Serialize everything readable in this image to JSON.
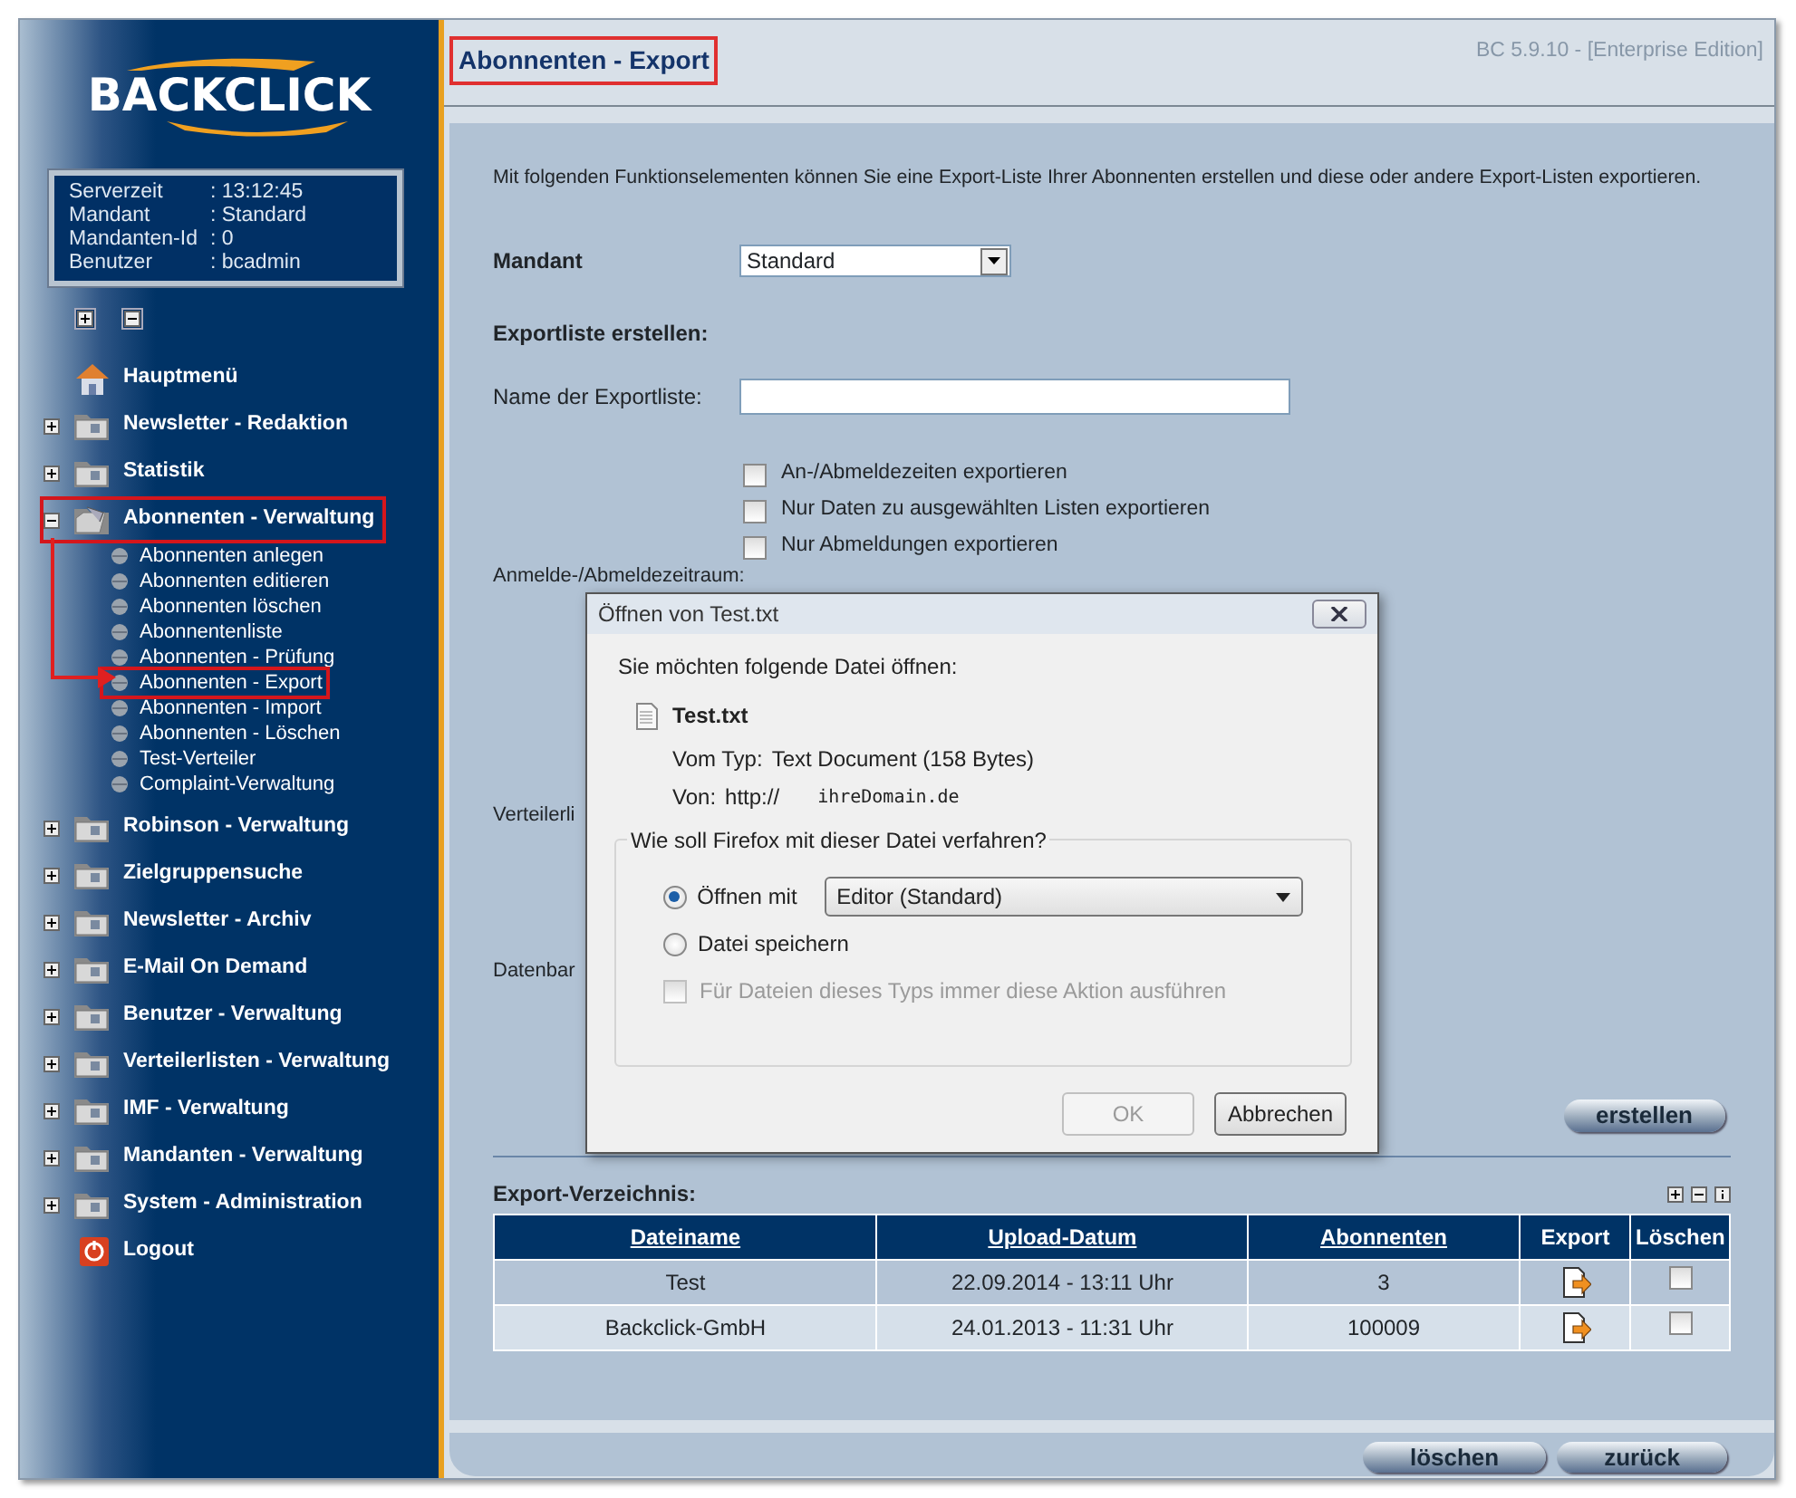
{
  "sidebar": {
    "logo": "BACKCLICK",
    "info": [
      {
        "label": "Serverzeit",
        "value": ":  13:12:45"
      },
      {
        "label": "Mandant",
        "value": ": Standard"
      },
      {
        "label": "Mandanten-Id",
        "value": ": 0"
      },
      {
        "label": "Benutzer",
        "value": ": bcadmin"
      }
    ],
    "items": [
      {
        "label": "Hauptmenü",
        "kind": "home"
      },
      {
        "label": "Newsletter - Redaktion",
        "kind": "folder",
        "expanded": false
      },
      {
        "label": "Statistik",
        "kind": "folder",
        "expanded": false
      },
      {
        "label": "Abonnenten - Verwaltung",
        "kind": "folder",
        "expanded": true,
        "children": [
          {
            "label": "Abonnenten anlegen",
            "selected": false
          },
          {
            "label": "Abonnenten editieren",
            "selected": false
          },
          {
            "label": "Abonnenten löschen",
            "selected": false
          },
          {
            "label": "Abonnentenliste",
            "selected": false
          },
          {
            "label": "Abonnenten - Prüfung",
            "selected": false
          },
          {
            "label": "Abonnenten - Export",
            "selected": true
          },
          {
            "label": "Abonnenten - Import",
            "selected": false
          },
          {
            "label": "Abonnenten - Löschen",
            "selected": false
          },
          {
            "label": "Test-Verteiler",
            "selected": false
          },
          {
            "label": "Complaint-Verwaltung",
            "selected": false
          }
        ]
      },
      {
        "label": "Robinson - Verwaltung",
        "kind": "folder",
        "expanded": false
      },
      {
        "label": "Zielgruppensuche",
        "kind": "folder",
        "expanded": false
      },
      {
        "label": "Newsletter - Archiv",
        "kind": "folder",
        "expanded": false
      },
      {
        "label": "E-Mail On Demand",
        "kind": "folder",
        "expanded": false
      },
      {
        "label": "Benutzer - Verwaltung",
        "kind": "folder",
        "expanded": false
      },
      {
        "label": "Verteilerlisten - Verwaltung",
        "kind": "folder",
        "expanded": false
      },
      {
        "label": "IMF - Verwaltung",
        "kind": "folder",
        "expanded": false
      },
      {
        "label": "Mandanten - Verwaltung",
        "kind": "folder",
        "expanded": false
      },
      {
        "label": "System - Administration",
        "kind": "folder",
        "expanded": false
      },
      {
        "label": "Logout",
        "kind": "logout"
      }
    ]
  },
  "main": {
    "title": "Abonnenten - Export",
    "version": "BC 5.9.10 - [Enterprise Edition]",
    "intro": "Mit folgenden Funktionselementen können Sie eine Export-Liste Ihrer Abonnenten erstellen und diese oder andere Export-Listen exportieren.",
    "mandant": {
      "label": "Mandant",
      "value": "Standard"
    },
    "section": "Exportliste erstellen:",
    "name_field": {
      "label": "Name der Exportliste:"
    },
    "options": [
      {
        "label": "An-/Abmeldezeiten exportieren",
        "checked": false
      },
      {
        "label": "Nur Daten zu ausgewählten Listen exportieren",
        "checked": false
      },
      {
        "label": "Nur Abmeldungen exportieren",
        "checked": false
      }
    ],
    "hidden_labels": [
      "Anmelde-/Abmeldezeitraum:",
      "Verteilerli",
      "Datenbar"
    ],
    "create_button": "erstellen",
    "export_title": "Export-Verzeichnis:",
    "table": {
      "columns": [
        {
          "label": "Dateiname",
          "link": true
        },
        {
          "label": "Upload-Datum",
          "link": true
        },
        {
          "label": "Abonnenten",
          "link": true
        },
        {
          "label": "Export",
          "link": false
        },
        {
          "label": "Löschen",
          "link": false
        }
      ],
      "rows": [
        {
          "name": "Test",
          "date": "22.09.2014 - 13:11 Uhr",
          "count": "3",
          "checked": false
        },
        {
          "name": "Backclick-GmbH",
          "date": "24.01.2013 - 11:31 Uhr",
          "count": "100009",
          "checked": false
        }
      ]
    },
    "footer_buttons": [
      "löschen",
      "zurück"
    ]
  },
  "dialog": {
    "title": "Öffnen von Test.txt",
    "prompt": "Sie möchten folgende Datei öffnen:",
    "file": "Test.txt",
    "type_label": "Vom Typ:",
    "type": "Text Document (158 Bytes)",
    "from_label": "Von:",
    "from": "http://",
    "domain": "ihreDomain.de",
    "legend": "Wie soll Firefox mit dieser Datei verfahren?",
    "choices": [
      {
        "label": "Öffnen mit",
        "selected": true
      },
      {
        "label": "Datei speichern",
        "selected": false
      }
    ],
    "app": "Editor (Standard)",
    "always": {
      "label": "Für Dateien dieses Typs immer diese Aktion ausführen",
      "checked": false,
      "disabled": true
    },
    "buttons": [
      {
        "label": "OK",
        "disabled": true
      },
      {
        "label": "Abbrechen",
        "disabled": false
      }
    ]
  }
}
